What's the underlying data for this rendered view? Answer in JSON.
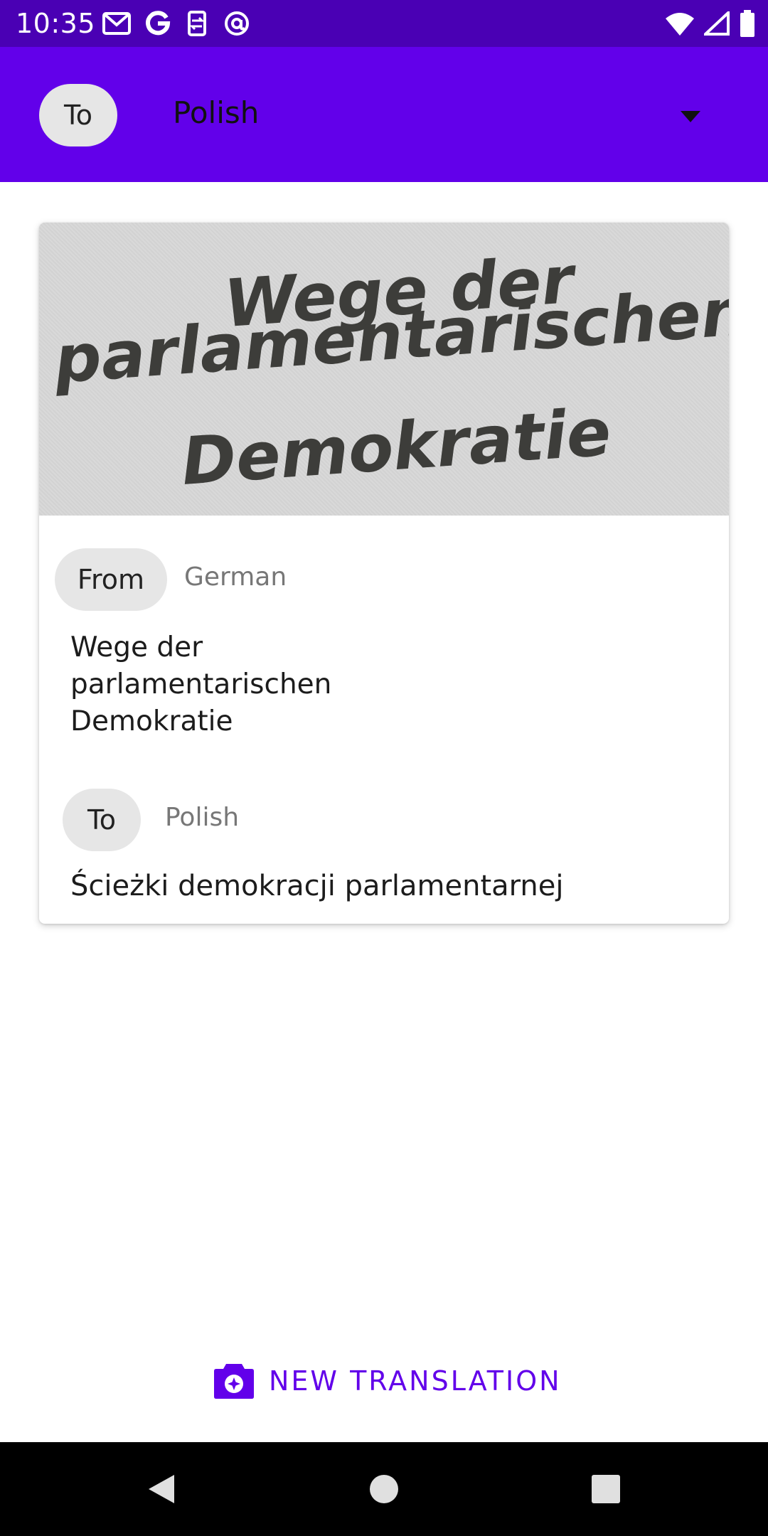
{
  "status_bar": {
    "time": "10:35",
    "left_icons": [
      "gmail-icon",
      "google-icon",
      "sync-icon",
      "at-sign-icon"
    ],
    "right_icons": [
      "wifi-icon",
      "cell-signal-icon",
      "battery-icon"
    ],
    "background": "#4a00b4"
  },
  "toolbar": {
    "chip_label": "To",
    "selected_language": "Polish",
    "background": "#6200ea"
  },
  "card": {
    "image_text_lines": [
      "Wege der",
      "parlamentarischen",
      "Demokratie"
    ],
    "from_chip": "From",
    "from_language": "German",
    "source_text": "Wege der\nparlamentarischen\nDemokratie",
    "to_chip": "To",
    "to_language": "Polish",
    "translated_text": "Ścieżki demokracji parlamentarnej"
  },
  "action": {
    "new_translation_label": "NEW TRANSLATION",
    "icon": "camera-icon",
    "accent": "#6200ea"
  },
  "nav_bar": {
    "buttons": [
      "back-icon",
      "home-icon",
      "recents-icon"
    ]
  }
}
